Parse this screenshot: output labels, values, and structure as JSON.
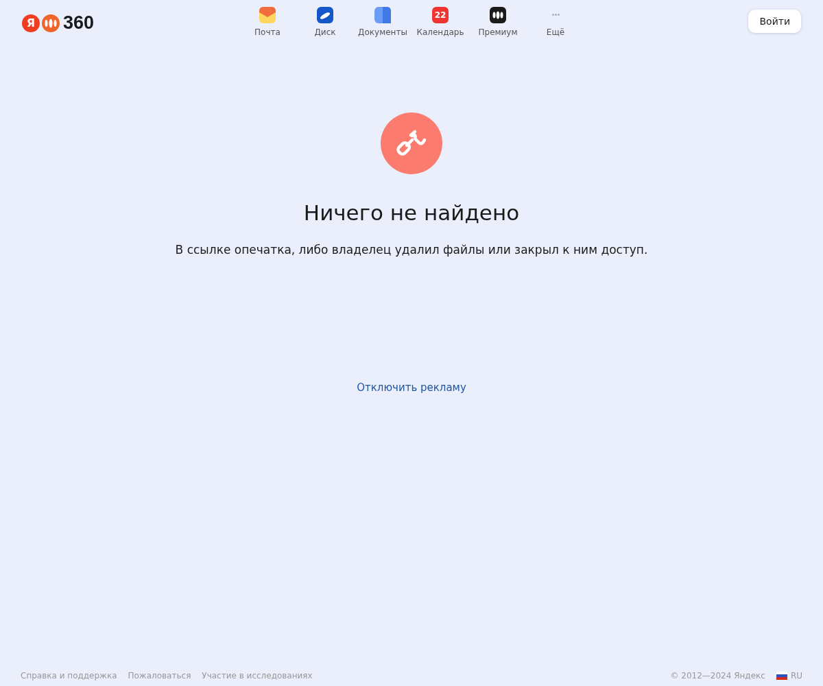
{
  "logo": {
    "letter": "Я",
    "text": "360"
  },
  "nav": [
    {
      "kind": "mail",
      "label": "Почта"
    },
    {
      "kind": "disk",
      "label": "Диск"
    },
    {
      "kind": "docs",
      "label": "Документы"
    },
    {
      "kind": "calendar",
      "label": "Календарь",
      "badge": "22"
    },
    {
      "kind": "premium",
      "label": "Премиум"
    },
    {
      "kind": "more",
      "label": "Ещё"
    }
  ],
  "login_button": "Войти",
  "message": {
    "title": "Ничего не найдено",
    "text": "В ссылке опечатка, либо владелец удалил файлы или закрыл к ним доступ."
  },
  "ad_link": "Отключить рекламу",
  "footer": {
    "links": [
      "Справка и поддержка",
      "Пожаловаться",
      "Участие в исследованиях"
    ],
    "copyright": "© 2012—2024 Яндекс",
    "language": "RU"
  }
}
